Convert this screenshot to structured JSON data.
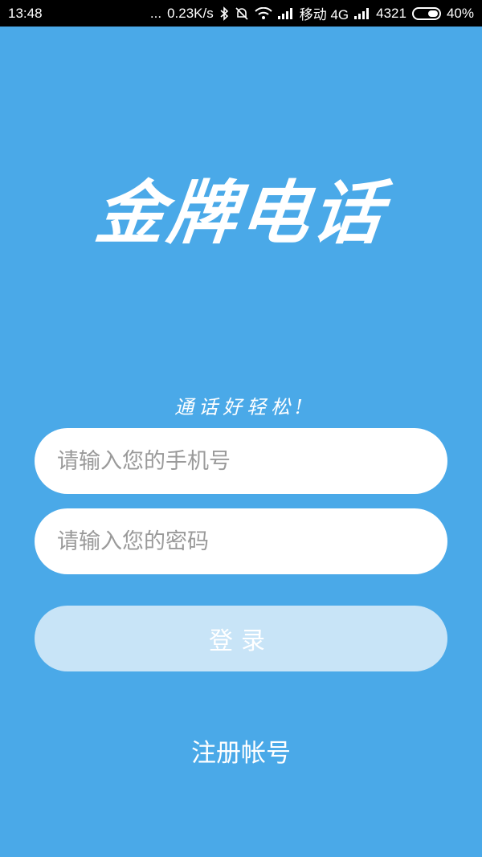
{
  "status_bar": {
    "time": "13:48",
    "dots": "...",
    "net_speed": "0.23K/s",
    "carrier": "移动 4G",
    "signal_value": "4321",
    "battery": "40%",
    "icons": [
      "bluetooth-icon",
      "mute-bell-icon",
      "wifi-icon",
      "signal-icon",
      "signal-icon",
      "battery-icon"
    ]
  },
  "app": {
    "logo_text": "金牌电话",
    "slogan": "通话好轻松!"
  },
  "form": {
    "phone_placeholder": "请输入您的手机号",
    "phone_value": "",
    "password_placeholder": "请输入您的密码",
    "password_value": "",
    "login_label": "登录",
    "register_label": "注册帐号"
  },
  "colors": {
    "background": "#4aa9e8",
    "login_button": "#c8e4f7"
  }
}
